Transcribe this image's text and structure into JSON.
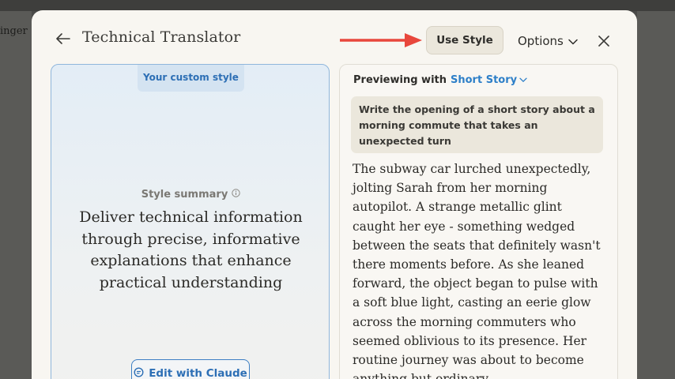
{
  "background": {
    "partial_text": "inger"
  },
  "header": {
    "title": "Technical Translator",
    "use_style_label": "Use Style",
    "options_label": "Options"
  },
  "left_panel": {
    "tag": "Your custom style",
    "summary_label": "Style summary",
    "summary_text": "Deliver technical information through precise, informative explanations that enhance practical understanding",
    "edit_button_label": "Edit with Claude"
  },
  "right_panel": {
    "preview_prefix": "Previewing with",
    "preview_style": "Short Story",
    "prompt": "Write the opening of a short story about a morning commute that takes an unexpected turn",
    "story": "The subway car lurched unexpectedly, jolting Sarah from her morning autopilot. A strange metallic glint caught her eye - something wedged between the seats that definitely wasn't there moments before. As she leaned forward, the object began to pulse with a soft blue light, casting an eerie glow across the morning commuters who seemed oblivious to its presence. Her routine journey was about to become anything but ordinary."
  },
  "colors": {
    "accent_blue": "#2d6fb5",
    "annotation_arrow": "#e8473c"
  }
}
